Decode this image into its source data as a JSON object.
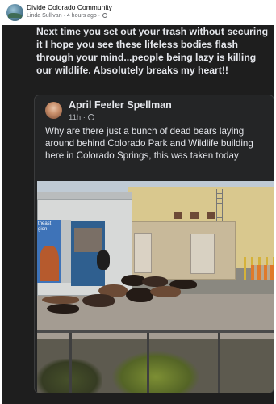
{
  "group": {
    "name": "Divide Colorado Community",
    "author": "Linda Sullivan",
    "separator": "·",
    "time": "4 hours ago",
    "separator2": "·"
  },
  "post": {
    "text": "Next time you set out your trash without securing it I hope you see these lifeless bodies flash through your mind...people being lazy is killing our wildlife. Absolutely breaks my heart!!"
  },
  "shared": {
    "author": "April Feeler Spellman",
    "time": "11h",
    "separator": "·",
    "text": "Why are there just a bunch of dead bears laying around behind Colorado Park and Wildlife building here in Colorado Springs, this was taken today"
  },
  "photo": {
    "banner_text": "theast gion"
  },
  "colors": {
    "dark_background": "#1e1e1e",
    "card_background": "#242526",
    "text_primary": "#e4e6eb",
    "text_secondary": "#b0b3b8",
    "meta_text": "#65676b"
  },
  "icons": {
    "group_avatar": "group-avatar-icon",
    "author_avatar": "author-avatar-icon",
    "privacy": "globe-icon"
  }
}
